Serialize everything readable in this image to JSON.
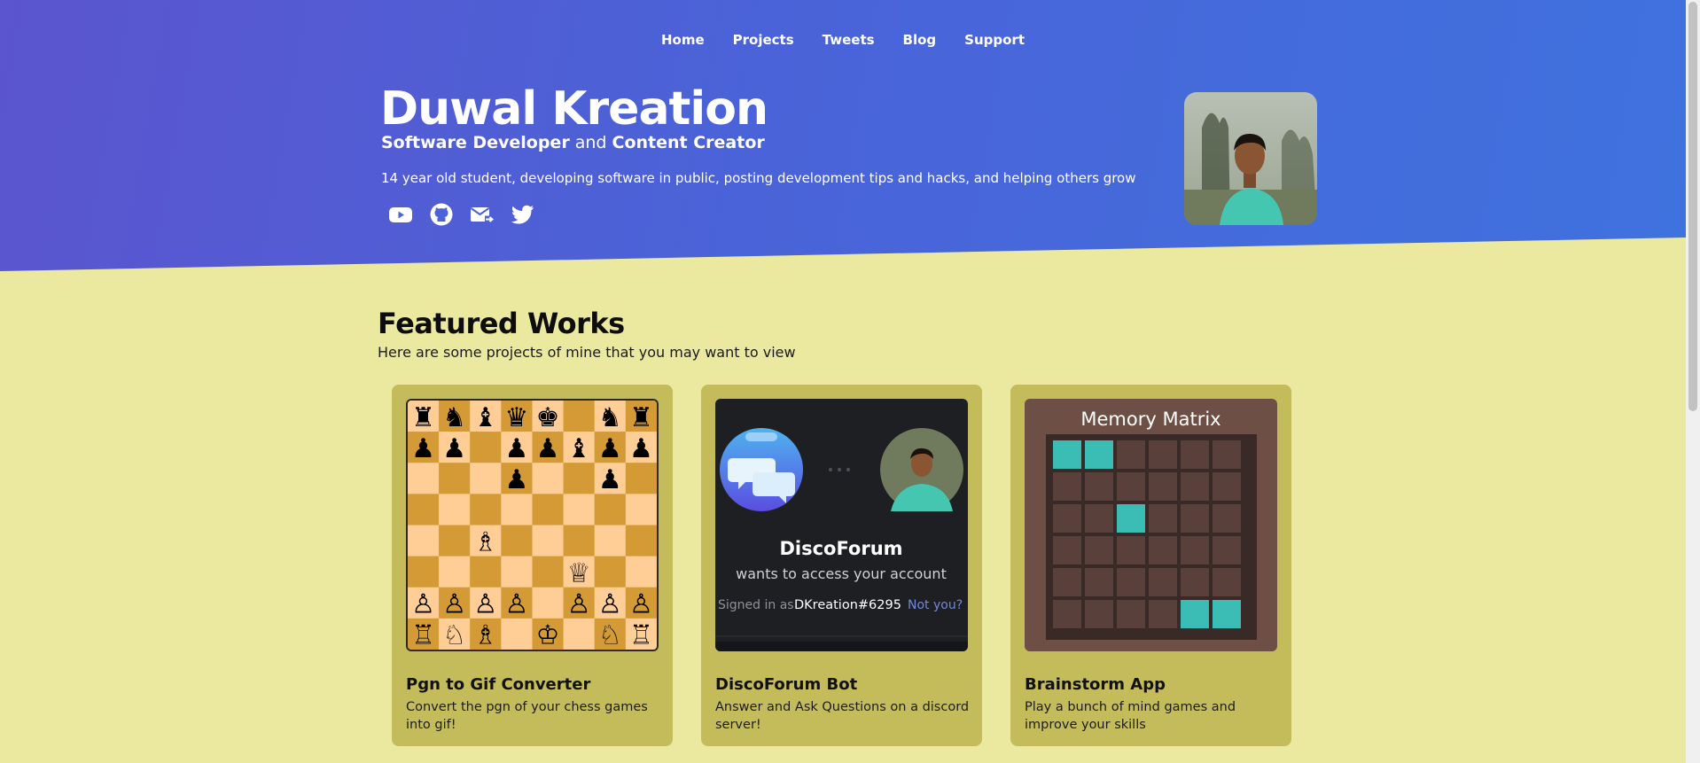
{
  "nav": {
    "items": [
      "Home",
      "Projects",
      "Tweets",
      "Blog",
      "Support"
    ]
  },
  "hero": {
    "title": "Duwal Kreation",
    "subtitle_role1": "Software Developer",
    "subtitle_and": " and ",
    "subtitle_role2": "Content Creator",
    "description": "14 year old student, developing software in public, posting development tips and hacks, and helping others grow",
    "socials": [
      "youtube-icon",
      "github-icon",
      "email-icon",
      "twitter-icon"
    ]
  },
  "featured": {
    "title": "Featured Works",
    "subtitle": "Here are some projects of mine that you may want to view",
    "cards": [
      {
        "title": "Pgn to Gif Converter",
        "description": "Convert the pgn of your chess games into gif!"
      },
      {
        "title": "DiscoForum Bot",
        "description": "Answer and Ask Questions on a discord server!"
      },
      {
        "title": "Brainstorm App",
        "description": "Play a bunch of mind games and improve your skills"
      }
    ],
    "discoforum_thumb": {
      "name": "DiscoForum",
      "line": "wants to access your account",
      "signed_in_as": "Signed in as",
      "user": "DKreation#6295",
      "not_you": "Not you?"
    },
    "memory_thumb": {
      "title": "Memory Matrix"
    }
  },
  "colors": {
    "hero_start": "#5b55cf",
    "hero_end": "#3f72de",
    "page_bg": "#ebe99f",
    "card_bg": "#c4bc5a",
    "chess_light": "#ffcd96",
    "chess_dark": "#d39a35",
    "memory_bg": "#6e4f45",
    "memory_active": "#3bbcb5"
  }
}
